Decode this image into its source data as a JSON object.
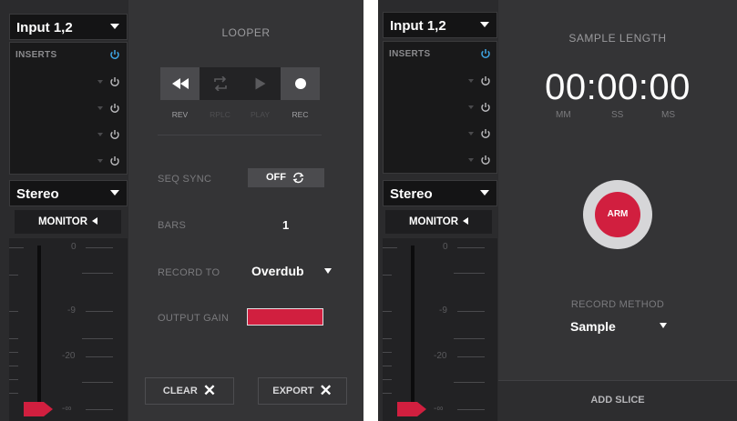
{
  "colors": {
    "accent_red": "#d11f3f",
    "panel_bg": "#343436",
    "strip_bg": "#2b2b2d",
    "power_active": "#3fa7e6"
  },
  "left_panel": {
    "channel_strip": {
      "input_select": {
        "value": "Input 1,2",
        "icon": "caret-down-icon"
      },
      "inserts": {
        "title": "INSERTS",
        "slots": 4
      },
      "stereo_select": {
        "value": "Stereo",
        "icon": "caret-down-icon"
      },
      "monitor": {
        "label": "MONITOR",
        "icon": "speaker-left-icon"
      },
      "meter": {
        "scale_top": "0",
        "scale_mid": "-9",
        "scale_low": "-20",
        "scale_bottom": "-∞"
      }
    },
    "looper": {
      "title": "LOOPER",
      "transport": [
        {
          "label": "REV",
          "icon": "rewind-icon",
          "enabled": true
        },
        {
          "label": "RPLC",
          "icon": "replace-loop-icon",
          "enabled": false
        },
        {
          "label": "PLAY",
          "icon": "play-icon",
          "enabled": false
        },
        {
          "label": "REC",
          "icon": "record-icon",
          "enabled": true
        }
      ],
      "seq_sync": {
        "label": "SEQ SYNC",
        "value": "OFF"
      },
      "bars": {
        "label": "BARS",
        "value": "1"
      },
      "record_to": {
        "label": "RECORD TO",
        "value": "Overdub"
      },
      "output_gain": {
        "label": "OUTPUT GAIN",
        "level": 1.0
      },
      "clear_button": "CLEAR",
      "export_button": "EXPORT"
    }
  },
  "right_panel": {
    "channel_strip": {
      "input_select": {
        "value": "Input 1,2",
        "icon": "caret-down-icon"
      },
      "inserts": {
        "title": "INSERTS",
        "slots": 4
      },
      "stereo_select": {
        "value": "Stereo",
        "icon": "caret-down-icon"
      },
      "monitor": {
        "label": "MONITOR",
        "icon": "speaker-left-icon"
      },
      "meter": {
        "scale_top": "0",
        "scale_mid": "-9",
        "scale_low": "-20",
        "scale_bottom": "-∞"
      }
    },
    "sampler": {
      "title": "SAMPLE LENGTH",
      "time": "00:00:00",
      "units": [
        "MM",
        "SS",
        "MS"
      ],
      "arm_label": "ARM",
      "record_method": {
        "label": "RECORD METHOD",
        "value": "Sample"
      },
      "add_slice": "ADD SLICE"
    }
  }
}
